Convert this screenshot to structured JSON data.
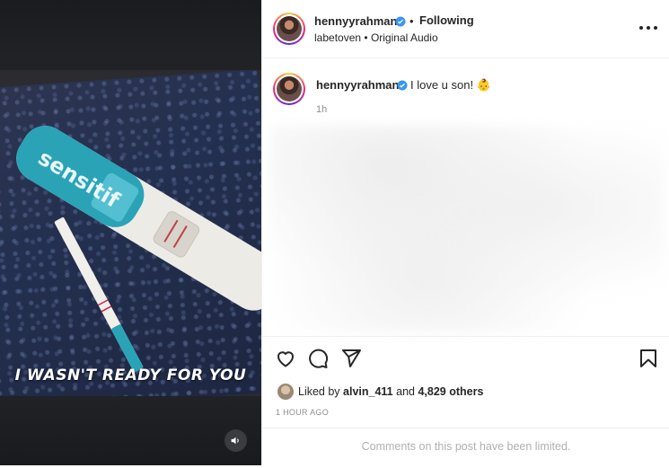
{
  "post": {
    "username": "hennyyrahman",
    "separator": "•",
    "following_label": "Following",
    "audio_artist": "labetoven",
    "audio_label": "Original Audio",
    "more_label": "More options"
  },
  "media": {
    "overlay_caption": "I WASN'T READY FOR YOU",
    "volume_icon": "volume-icon"
  },
  "caption": {
    "username": "hennyyrahman",
    "text": "I love u son! 👶",
    "time": "1h"
  },
  "actions": {
    "like_icon": "heart-icon",
    "comment_icon": "comment-icon",
    "share_icon": "share-icon",
    "save_icon": "bookmark-icon"
  },
  "likes": {
    "prefix": "Liked by ",
    "user": "alvin_411",
    "middle": " and ",
    "others": "4,829 others"
  },
  "timestamp": "1 HOUR AGO",
  "comments_notice": "Comments on this post have been limited.",
  "colors": {
    "verified": "#3897f0",
    "text": "#262626",
    "muted": "#8e8e8e",
    "test_teal": "#2aa3b7"
  }
}
